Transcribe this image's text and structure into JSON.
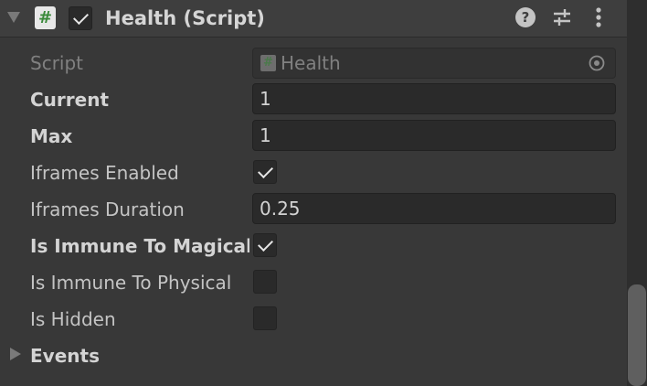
{
  "component": {
    "title": "Health (Script)",
    "enabled": true,
    "icons": [
      "foldout-arrow-icon",
      "script-icon",
      "help-icon",
      "presets-icon",
      "more-icon"
    ]
  },
  "properties": {
    "script": {
      "label": "Script",
      "value": "Health"
    },
    "current": {
      "label": "Current",
      "value": "1"
    },
    "max": {
      "label": "Max",
      "value": "1"
    },
    "iframes_enabled": {
      "label": "Iframes Enabled",
      "checked": true
    },
    "iframes_duration": {
      "label": "Iframes Duration",
      "value": "0.25"
    },
    "immune_magical": {
      "label": "Is Immune To Magical",
      "checked": true
    },
    "immune_physical": {
      "label": "Is Immune To Physical",
      "checked": false
    },
    "is_hidden": {
      "label": "Is Hidden",
      "checked": false
    }
  },
  "events": {
    "label": "Events"
  },
  "colors": {
    "background": "#383838",
    "header": "#3e3e3e",
    "field": "#2a2a2a",
    "text": "#c4c4c4",
    "script_icon_green": "#3a8a3a"
  }
}
